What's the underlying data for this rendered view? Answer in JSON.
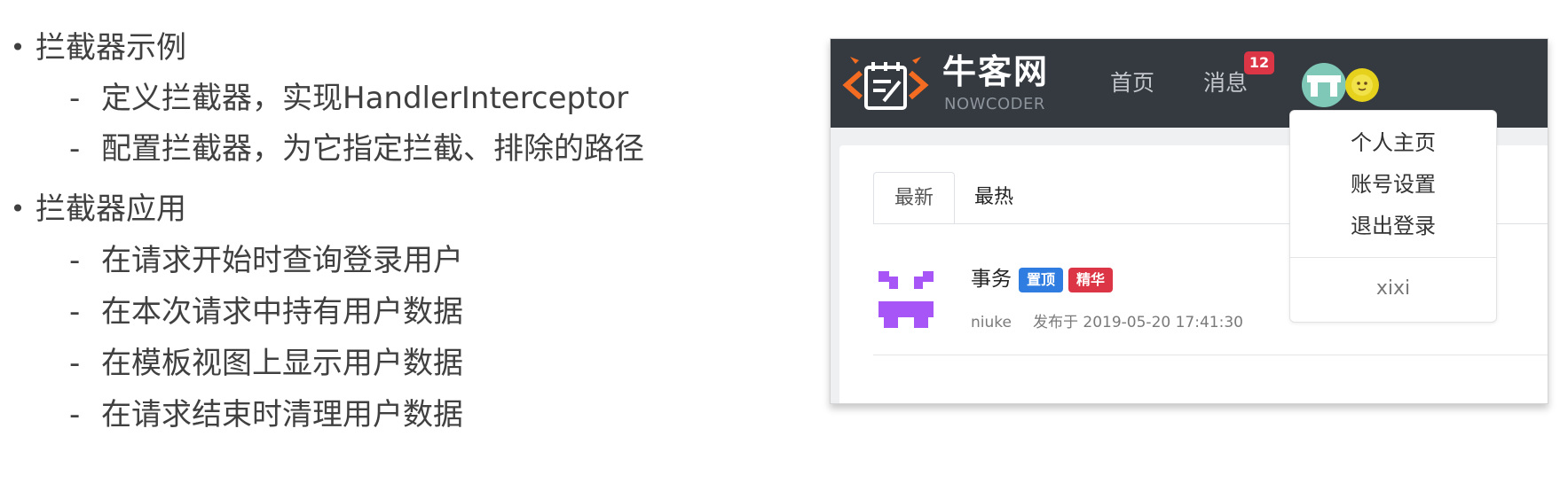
{
  "outline": [
    {
      "level": 1,
      "text": "拦截器示例"
    },
    {
      "level": 2,
      "text": "定义拦截器，实现HandlerInterceptor"
    },
    {
      "level": 2,
      "text": "配置拦截器，为它指定拦截、排除的路径"
    },
    {
      "level": 1,
      "text": "拦截器应用"
    },
    {
      "level": 2,
      "text": "在请求开始时查询登录用户"
    },
    {
      "level": 2,
      "text": "在本次请求中持有用户数据"
    },
    {
      "level": 2,
      "text": "在模板视图上显示用户数据"
    },
    {
      "level": 2,
      "text": "在请求结束时清理用户数据"
    }
  ],
  "bullet_char": "•",
  "dash_char": "-",
  "screenshot": {
    "brand": {
      "name": "牛客网",
      "subtitle": "NOWCODER"
    },
    "nav": {
      "home": "首页",
      "messages": "消息",
      "message_badge": "12"
    },
    "tabs": [
      "最新",
      "最热"
    ],
    "post": {
      "title": "事务",
      "tags": [
        "置顶",
        "精华"
      ],
      "author": "niuke",
      "published": "发布于 2019-05-20 17:41:30"
    },
    "dropdown": {
      "items": [
        "个人主页",
        "账号设置",
        "退出登录"
      ],
      "username": "xixi"
    },
    "colors": {
      "navbar": "#343a40",
      "badge": "#dc3545",
      "tag_top": "#2f7de1",
      "tag_fine": "#dc3545",
      "logo_orange": "#f36c21",
      "avatar_purple": "#a855f7"
    },
    "icons": [
      "nowcoder-logo-icon",
      "user-avatar-icon",
      "small-avatar-icon",
      "post-author-avatar-icon"
    ]
  }
}
